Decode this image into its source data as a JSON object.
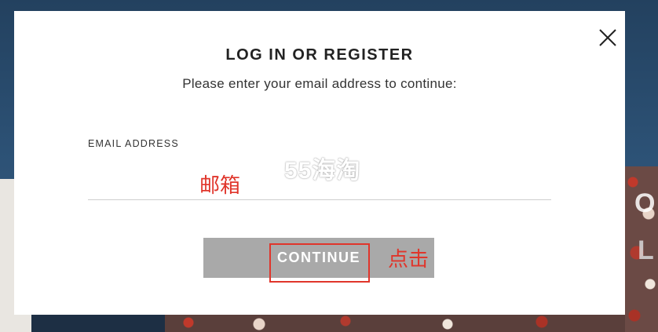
{
  "modal": {
    "title": "LOG IN OR REGISTER",
    "subtitle": "Please enter your email address to continue:",
    "email_label": "EMAIL ADDRESS",
    "email_value": "",
    "email_placeholder": "",
    "continue_label": "CONTINUE",
    "close_icon": "close-icon"
  },
  "background": {
    "letters": [
      "O",
      "L"
    ]
  },
  "overlay": {
    "watermark": "55海淘",
    "email_annotation": "邮箱",
    "click_annotation": "点击",
    "annotation_color": "#e0352b"
  },
  "colors": {
    "button_bg": "#a9a9a9",
    "backdrop": "#2c5175"
  }
}
